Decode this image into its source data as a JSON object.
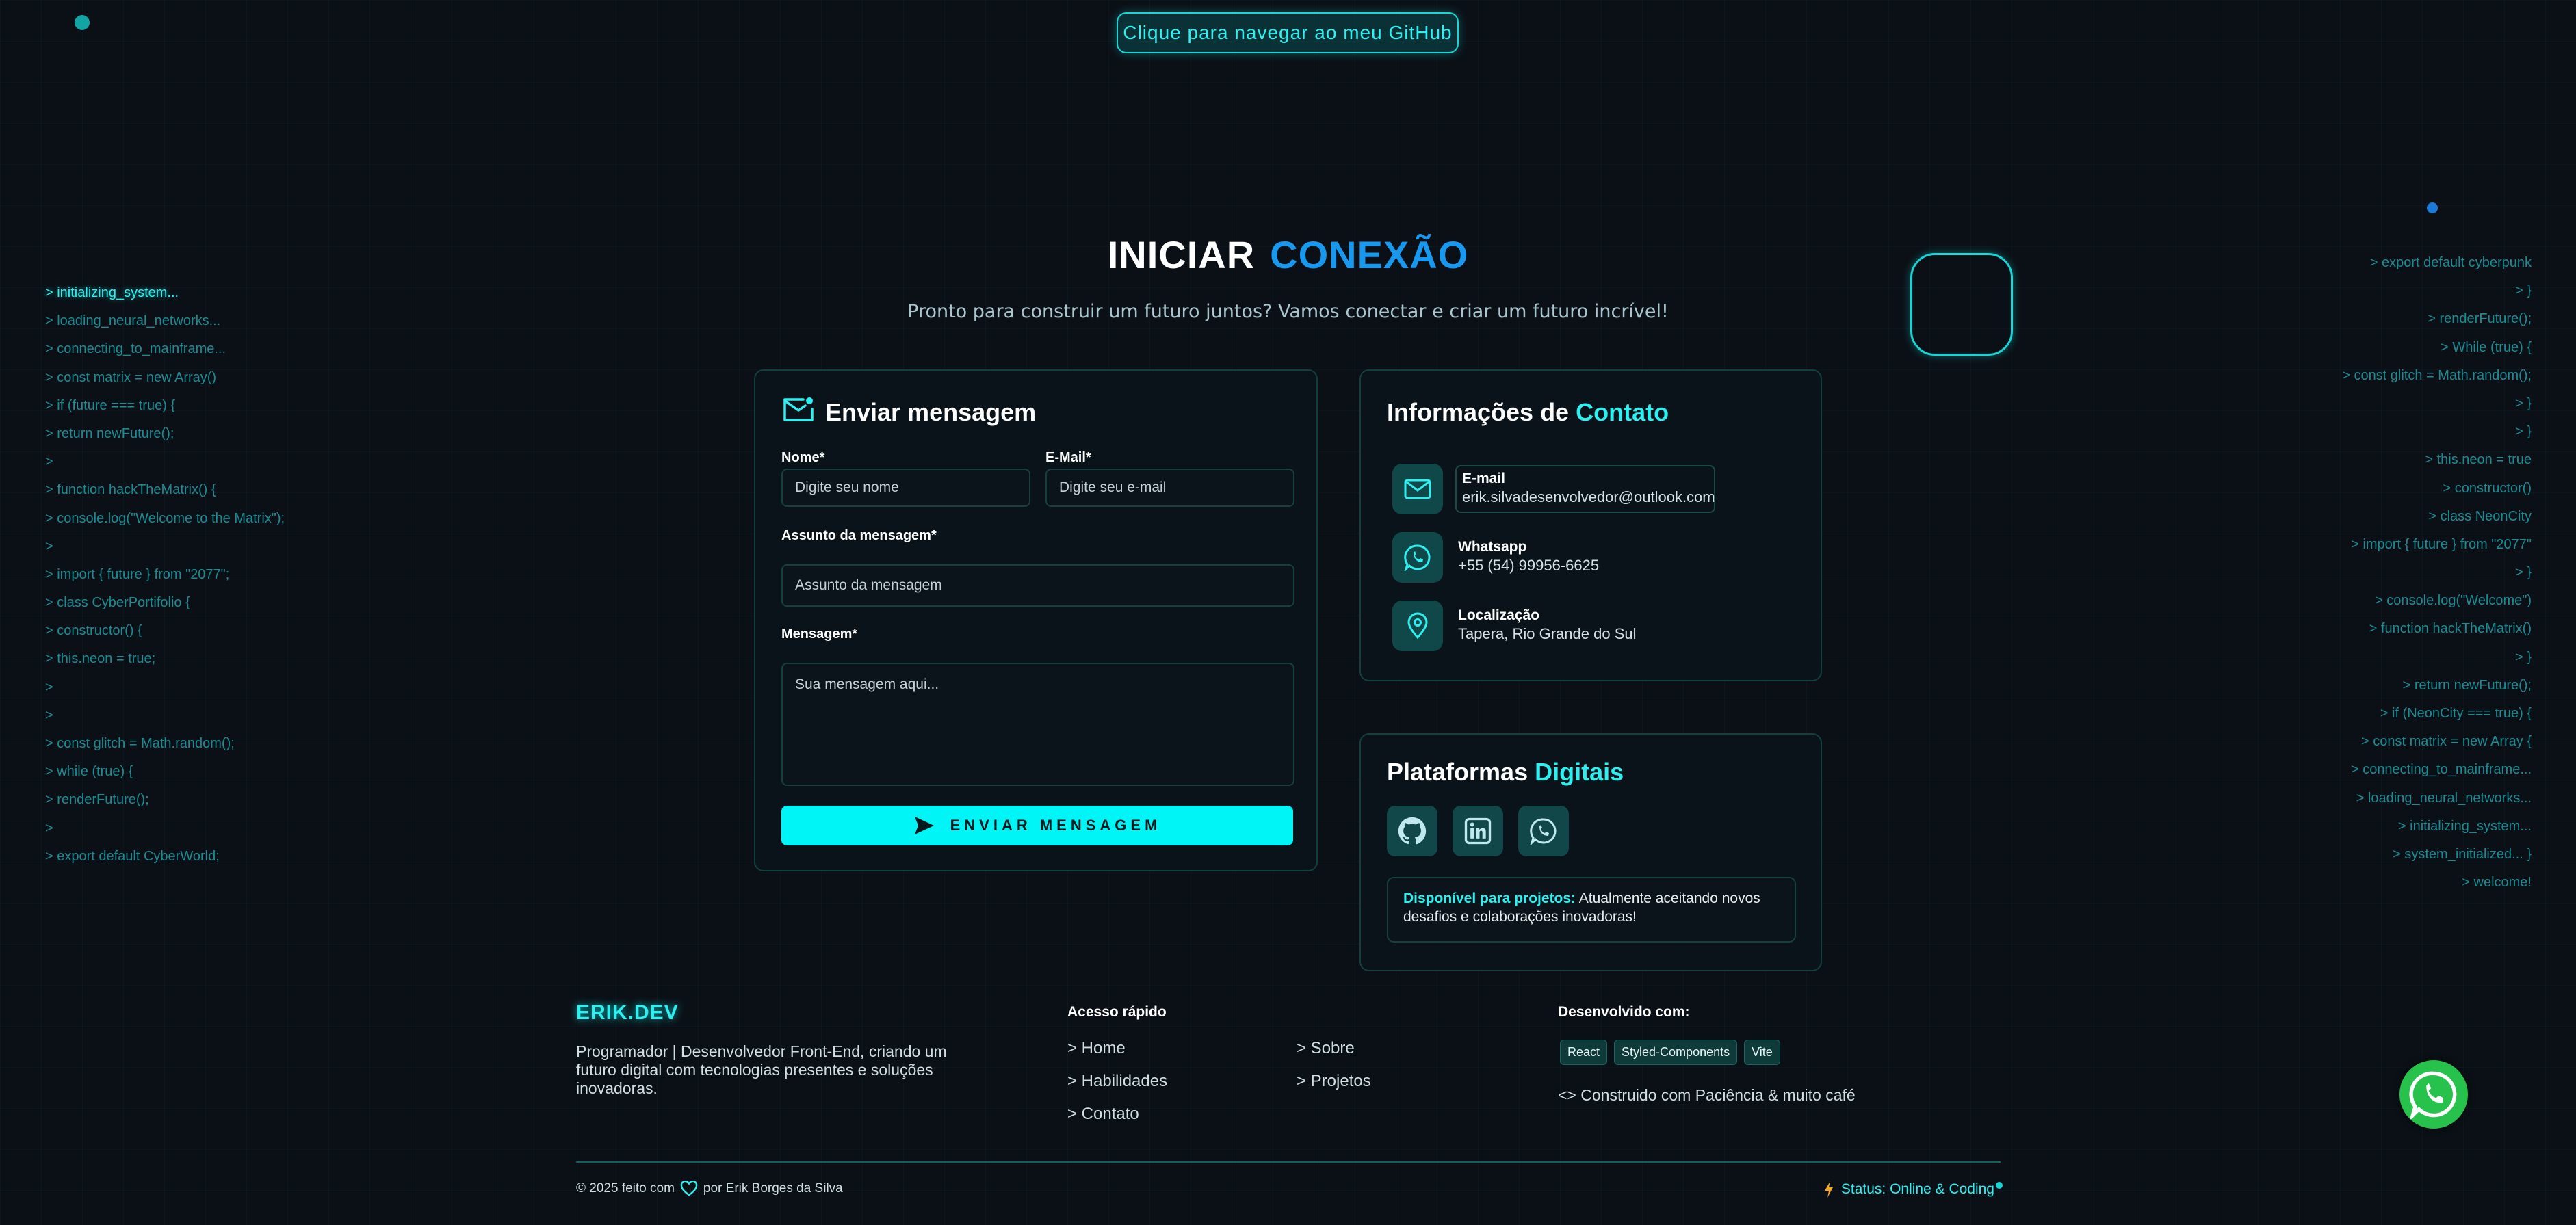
{
  "top": {
    "github_button": "Clique para navegar ao meu GitHub"
  },
  "code_left": [
    "> initializing_system...",
    "> loading_neural_networks...",
    "> connecting_to_mainframe...",
    "> const matrix = new Array()",
    "> if (future === true) {",
    "> return newFuture();",
    ">",
    "> function hackTheMatrix() {",
    "> console.log(\"Welcome to the Matrix\");",
    ">",
    "> import { future } from \"2077\";",
    "> class CyberPortifolio {",
    "> constructor() {",
    "> this.neon = true;",
    ">",
    ">",
    "> const glitch = Math.random();",
    "> while (true) {",
    "> renderFuture();",
    ">",
    "> export default CyberWorld;"
  ],
  "code_right": [
    "> export default cyberpunk",
    "> }",
    "> renderFuture();",
    "> While (true) {",
    "> const glitch = Math.random();",
    "> }",
    "> }",
    "> this.neon = true",
    "> constructor()",
    "> class NeonCity",
    "> import { future } from \"2077\"",
    "> }",
    "> console.log(\"Welcome\")",
    "> function hackTheMatrix()",
    "> }",
    "> return newFuture();",
    "> if (NeonCity === true) {",
    "> const matrix = new Array {",
    "> connecting_to_mainframe...",
    "> loading_neural_networks...",
    "> initializing_system...",
    "> system_initialized... }",
    "> welcome!"
  ],
  "hero": {
    "title_white": "INICIAR",
    "title_blue": "CONEXÃO",
    "subtitle": "Pronto para construir um futuro juntos? Vamos conectar e criar um futuro incrível!"
  },
  "form": {
    "title": "Enviar mensagem",
    "name_label": "Nome*",
    "name_placeholder": "Digite seu nome",
    "email_label": "E-Mail*",
    "email_placeholder": "Digite seu e-mail",
    "subject_label": "Assunto da mensagem*",
    "subject_placeholder": "Assunto da mensagem",
    "message_label": "Mensagem*",
    "message_placeholder": "Sua mensagem aqui...",
    "send_label": "ENVIAR MENSAGEM"
  },
  "info": {
    "title_white": "Informações de",
    "title_cyan": "Contato",
    "email_title": "E-mail",
    "email_value": "erik.silvadesenvolvedor@outlook.com",
    "whatsapp_title": "Whatsapp",
    "whatsapp_value": "+55 (54) 99956-6625",
    "location_title": "Localização",
    "location_value": "Tapera, Rio Grande do Sul"
  },
  "platforms": {
    "title_white": "Plataformas",
    "title_cyan": "Digitais",
    "avail_bold": "Disponível para projetos:",
    "avail_text": " Atualmente aceitando novos desafios e colaborações inovadoras!"
  },
  "footer": {
    "brand": "ERIK.DEV",
    "description": "Programador | Desenvolvedor Front-End, criando um futuro digital com tecnologias presentes e soluções inovadoras.",
    "quick_title": "Acesso rápido",
    "links": [
      "> Home",
      "> Sobre",
      "> Habilidades",
      "> Projetos",
      "> Contato"
    ],
    "dev_title": "Desenvolvido com:",
    "tags": [
      "React",
      "Styled-Components",
      "Vite"
    ],
    "built": "<> Construido com Paciência & muito café",
    "copy_left": "© 2025 feito com",
    "copy_right": "por Erik Borges da Silva",
    "status": "Status: Online & Coding"
  },
  "colors": {
    "background": "#0b1016",
    "accent_cyan": "#00f6f6",
    "accent_blue": "#1899f0",
    "whatsapp_green": "#27c24c"
  }
}
